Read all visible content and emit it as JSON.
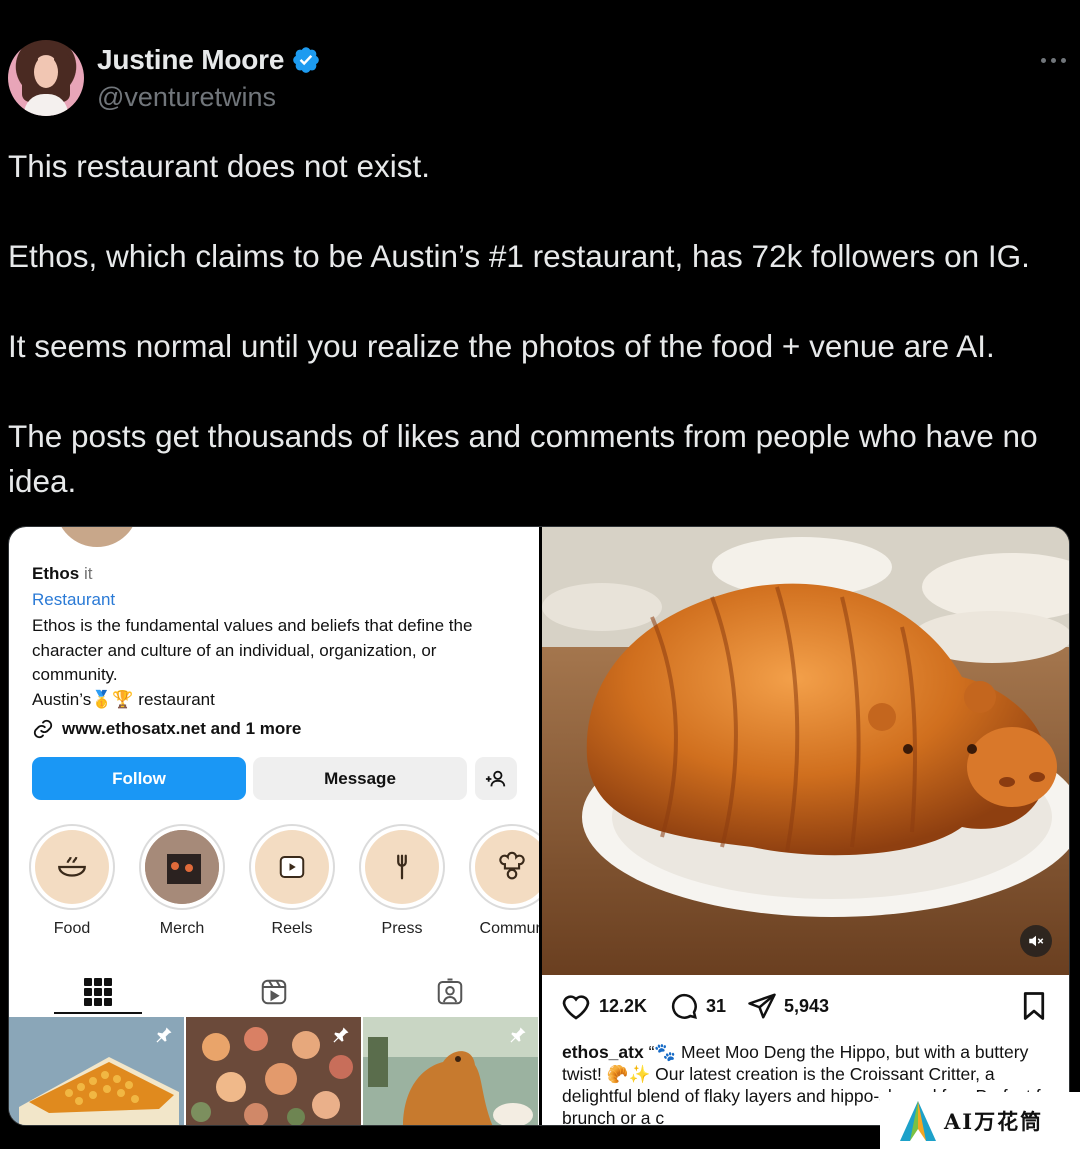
{
  "tweet": {
    "author_name": "Justine Moore",
    "handle": "@venturetwins",
    "verified_icon": "verified-badge-icon",
    "more_icon": "more-horizontal-icon",
    "text_lines": [
      "This restaurant does not exist.",
      "Ethos, which claims to be Austin’s #1 restaurant, has 72k followers on IG.",
      "It seems normal until you realize the photos of the food + venue are AI.",
      "The posts get thousands of likes and comments from people who have no idea."
    ]
  },
  "ig_profile": {
    "name": "Ethos",
    "pronoun": "it",
    "category": "Restaurant",
    "bio": "Ethos is the fundamental values and beliefs that define the character and culture of an individual, organization, or community.",
    "bio_line2_prefix": "Austin’s",
    "bio_line2_emoji": "🥇🏆",
    "bio_line2_suffix": "restaurant",
    "link_text": "www.ethosatx.net and 1 more",
    "follow_label": "Follow",
    "message_label": "Message",
    "highlights": [
      {
        "label": "Food",
        "icon": "bowl-icon"
      },
      {
        "label": "Merch",
        "icon": "merch-photo"
      },
      {
        "label": "Reels",
        "icon": "reels-play-icon"
      },
      {
        "label": "Press",
        "icon": "fork-icon"
      },
      {
        "label": "Commun",
        "icon": "chef-icon"
      }
    ],
    "tabs": [
      "grid-icon",
      "reels-icon",
      "tagged-icon"
    ]
  },
  "ig_post": {
    "likes": "12.2K",
    "comments": "31",
    "shares": "5,943",
    "caption_user": "ethos_atx",
    "caption_text": "“🐾 Meet Moo Deng the Hippo, but with a buttery twist! 🥐✨ Our latest creation is the Croissant Critter, a delightful blend of flaky layers and hippo-shaped fun. Perfect for brunch or a c"
  },
  "watermark": {
    "text": "AI万花筒"
  },
  "colors": {
    "background": "#000000",
    "text_primary": "#e7e9ea",
    "text_secondary": "#71767b",
    "verified_blue": "#1d9bf0",
    "ig_follow_blue": "#1a97f5",
    "ig_link_blue": "#2a7ad6"
  }
}
